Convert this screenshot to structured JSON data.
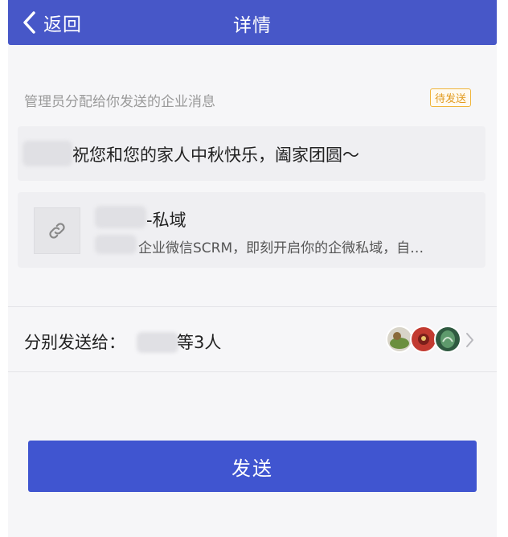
{
  "header": {
    "back_label": "返回",
    "title": "详情",
    "bar_color": "#4757c8"
  },
  "message": {
    "subtitle": "管理员分配给你发送的企业消息",
    "status_badge": "待发送",
    "text": "祝您和您的家人中秋快乐，阖家团圆～"
  },
  "link_card": {
    "icon": "link-icon",
    "title": "-私域",
    "description": "企业微信SCRM，即刻开启你的企微私域，自…"
  },
  "recipients": {
    "label": "分别发送给：",
    "count_text": "等3人",
    "avatar_colors": [
      "#7a9a52",
      "#c23a30",
      "#3d6e4e"
    ]
  },
  "actions": {
    "send_label": "发送",
    "accent": "#4055d0"
  }
}
